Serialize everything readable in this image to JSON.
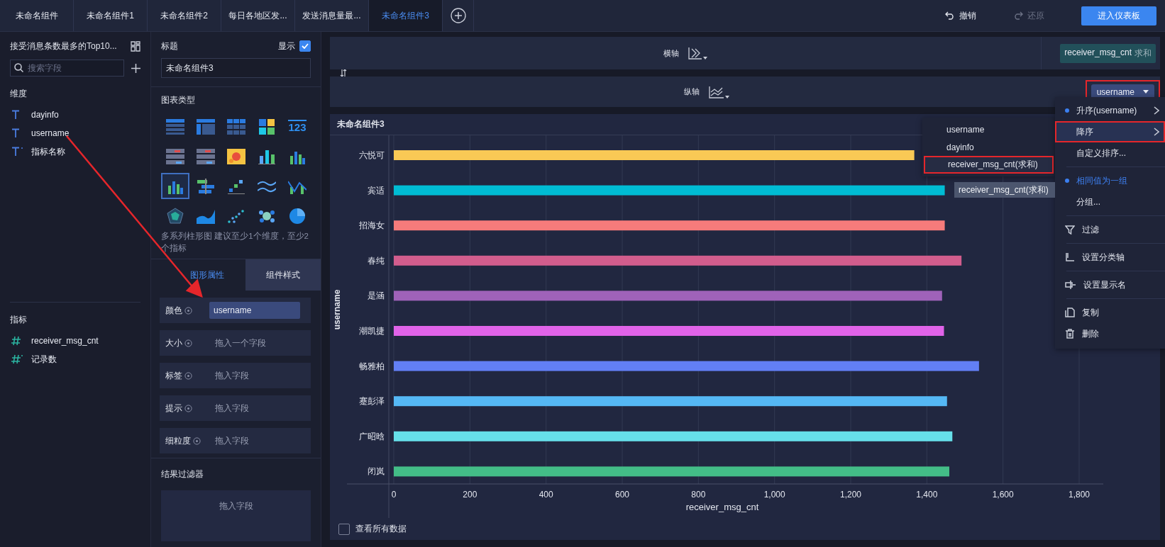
{
  "tabs": [
    {
      "label": "未命名组件",
      "selected": false
    },
    {
      "label": "未命名组件1",
      "selected": false
    },
    {
      "label": "未命名组件2",
      "selected": false
    },
    {
      "label": "每日各地区发...",
      "selected": false
    },
    {
      "label": "发送消息量最...",
      "selected": false
    },
    {
      "label": "未命名组件3",
      "selected": true
    }
  ],
  "toolbar": {
    "undo": {
      "label": "撤销",
      "disabled": false
    },
    "redo": {
      "label": "还原",
      "disabled": true
    },
    "dashboard_button": "进入仪表板"
  },
  "data_panel": {
    "title": "接受消息条数最多的Top10...",
    "search": {
      "placeholder": "搜索字段"
    },
    "dimensions": {
      "heading": "维度",
      "items": [
        {
          "label": "dayinfo",
          "kind": "text"
        },
        {
          "label": "username",
          "kind": "text"
        },
        {
          "label": "指标名称",
          "kind": "text-calc"
        }
      ]
    },
    "measures": {
      "heading": "指标",
      "items": [
        {
          "label": "receiver_msg_cnt",
          "kind": "number"
        },
        {
          "label": "记录数",
          "kind": "number-calc"
        }
      ]
    }
  },
  "settings_panel": {
    "title_label": "标题",
    "show_label": "显示",
    "show_checked": true,
    "title_value": "未命名组件3",
    "chart_types_heading": "图表类型",
    "chart_types": [
      {
        "kind": "table",
        "selected": false
      },
      {
        "kind": "pivot",
        "selected": false
      },
      {
        "kind": "grid",
        "selected": false
      },
      {
        "kind": "blocks",
        "selected": false
      },
      {
        "kind": "number",
        "label": "123",
        "selected": false
      },
      {
        "kind": "list",
        "selected": false
      },
      {
        "kind": "list",
        "selected": false
      },
      {
        "kind": "heatmap",
        "selected": false
      },
      {
        "kind": "stacked",
        "selected": false
      },
      {
        "kind": "bars",
        "selected": false
      },
      {
        "kind": "bars",
        "selected": true
      },
      {
        "kind": "hbars",
        "selected": false
      },
      {
        "kind": "steps",
        "selected": false
      },
      {
        "kind": "lines",
        "selected": false
      },
      {
        "kind": "combo",
        "selected": false
      },
      {
        "kind": "radar",
        "selected": false
      },
      {
        "kind": "area",
        "selected": false
      },
      {
        "kind": "scatter",
        "selected": false
      },
      {
        "kind": "bubbles",
        "selected": false
      },
      {
        "kind": "pie",
        "selected": false
      }
    ],
    "chart_type_hint": "多系列柱形图 建议至少1个维度，至少2个指标",
    "tabs": [
      {
        "label": "图形属性",
        "selected": true
      },
      {
        "label": "组件样式",
        "selected": false
      }
    ],
    "fields": [
      {
        "label": "颜色",
        "value": "username"
      },
      {
        "label": "大小",
        "hint": "拖入一个字段"
      },
      {
        "label": "标签",
        "hint": "拖入字段"
      },
      {
        "label": "提示",
        "hint": "拖入字段"
      },
      {
        "label": "细粒度",
        "hint": "拖入字段"
      }
    ],
    "result_filter": {
      "heading": "结果过滤器",
      "hint": "拖入字段"
    }
  },
  "axes": {
    "x": {
      "label": "横轴",
      "field": "receiver_msg_cnt",
      "aggregation": "求和"
    },
    "y": {
      "label": "纵轴",
      "field": "username",
      "highlighted": true
    }
  },
  "card": {
    "title": "未命名组件3",
    "chart_data": {
      "type": "bar",
      "orientation": "horizontal",
      "xlabel": "receiver_msg_cnt",
      "ylabel": "username",
      "categories": [
        "六悦可",
        "宾适",
        "招海女",
        "春纯",
        "是涵",
        "潮凯捷",
        "畅雅柏",
        "蹇彭泽",
        "广昭晗",
        "闭岚"
      ],
      "grid": true,
      "series": [
        {
          "values": [
            1367,
            1447,
            1447,
            1491,
            1440,
            1445,
            1537,
            1453,
            1467,
            1459
          ]
        }
      ],
      "colors": [
        "#f9c955",
        "#00bcd4",
        "#f67b7b",
        "#d25d8d",
        "#9f62b9",
        "#e063e8",
        "#627ff5",
        "#55b8f5",
        "#66e0ea",
        "#43bd87"
      ],
      "xlim": [
        0,
        1800
      ],
      "xticks": [
        0,
        200,
        400,
        600,
        800,
        {
          "value": 1000,
          "label": "1,000"
        },
        {
          "value": 1200,
          "label": "1,200"
        },
        {
          "value": 1400,
          "label": "1,400"
        },
        {
          "value": 1600,
          "label": "1,600"
        },
        {
          "value": 1800,
          "label": "1,800"
        }
      ]
    },
    "show_all": {
      "label": "查看所有数据",
      "checked": false
    }
  },
  "field_menu": {
    "items": [
      {
        "kind": "option",
        "label": "升序(username)",
        "selected": true,
        "submenu": true,
        "highlighted": false
      },
      {
        "kind": "option",
        "label": "降序",
        "selected": false,
        "submenu": true,
        "highlighted": true
      },
      {
        "kind": "option",
        "label": "自定义排序...",
        "selected": false,
        "submenu": false,
        "highlighted": false
      },
      {
        "kind": "divider"
      },
      {
        "kind": "option",
        "label": "相同值为一组",
        "selected": true,
        "submenu": false,
        "highlighted": false
      },
      {
        "kind": "option",
        "label": "分组...",
        "selected": false,
        "submenu": false,
        "highlighted": false
      },
      {
        "kind": "divider"
      },
      {
        "kind": "filter",
        "label": "过滤"
      },
      {
        "kind": "divider"
      },
      {
        "kind": "axis",
        "label": "设置分类轴"
      },
      {
        "kind": "divider"
      },
      {
        "kind": "rename",
        "label": "设置显示名"
      },
      {
        "kind": "divider"
      },
      {
        "kind": "copy",
        "label": "复制"
      },
      {
        "kind": "trash",
        "label": "删除"
      }
    ]
  },
  "submenu": {
    "items": [
      {
        "label": "username",
        "highlighted": false
      },
      {
        "label": "dayinfo",
        "highlighted": false
      },
      {
        "label": "receiver_msg_cnt(求和)",
        "highlighted": true
      }
    ]
  },
  "tooltip": "receiver_msg_cnt(求和)",
  "annotation": {
    "kind": "arrow"
  }
}
